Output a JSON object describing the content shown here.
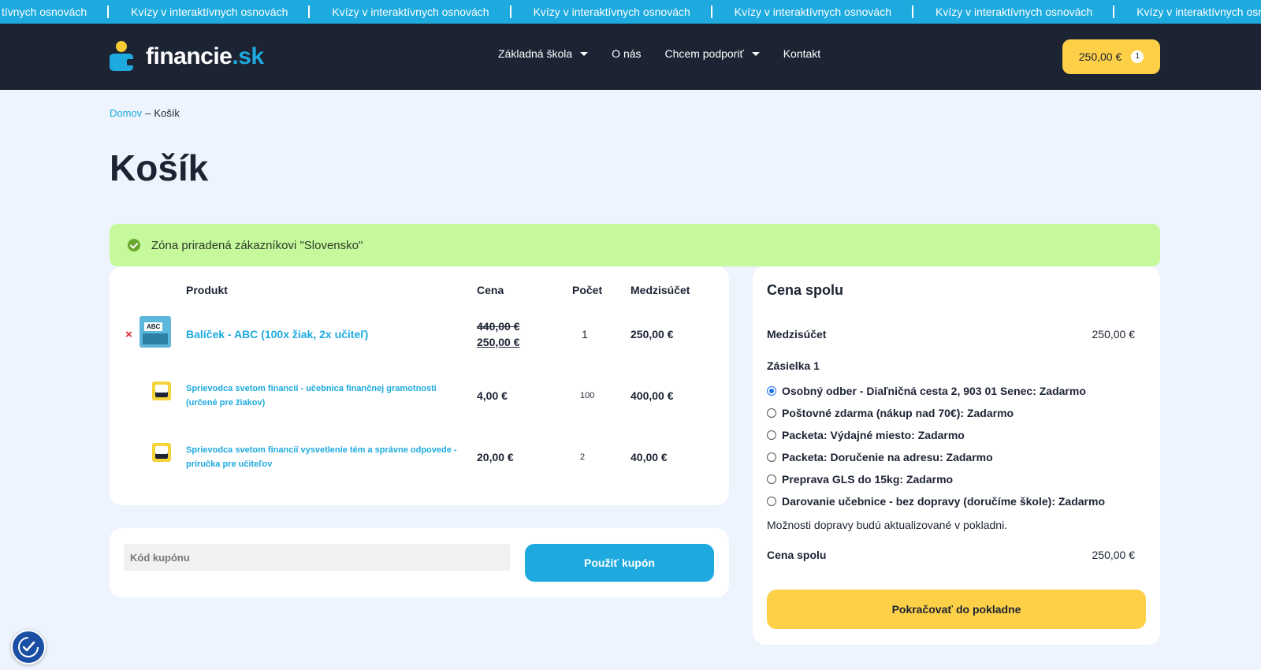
{
  "ticker": {
    "items": [
      "tívnych osnovách",
      "Kvízy v interaktívnych osnovách",
      "Kvízy v interaktívnych osnovách",
      "Kvízy v interaktívnych osnovách",
      "Kvízy v interaktívnych osnovách",
      "Kvízy v interaktívnych osnovách",
      "Kvízy v interaktívnych osnovách"
    ]
  },
  "header": {
    "logo_main": "financie",
    "logo_tld": ".sk",
    "nav": [
      {
        "label": "Základná škola",
        "icon": "chevron-down-icon"
      },
      {
        "label": "O nás"
      },
      {
        "label": "Chcem podporiť",
        "icon": "chevron-down-icon"
      },
      {
        "label": "Kontakt"
      }
    ],
    "cart_total": "250,00 €",
    "cart_count": "1"
  },
  "breadcrumb": {
    "home": "Domov",
    "separator": "–",
    "current": "Košík"
  },
  "page_title": "Košík",
  "notice": {
    "icon": "check-circle-icon",
    "text": "Zóna priradená zákazníkovi \"Slovensko\""
  },
  "cart": {
    "headers": {
      "product": "Produkt",
      "price": "Cena",
      "qty": "Počet",
      "subtotal": "Medzisúčet"
    },
    "items": [
      {
        "name": "Balíček - ABC (100x žiak, 2x učiteľ)",
        "old_price": "440,00 €",
        "price": "250,00 €",
        "qty": "1",
        "subtotal": "250,00 €",
        "remove_icon": "×"
      },
      {
        "name": "Sprievodca svetom financií - učebnica finančnej gramotnosti (určené pre žiakov)",
        "price": "4,00 €",
        "qty": "100",
        "subtotal": "400,00 €"
      },
      {
        "name": "Sprievodca svetom financií vysvetlenie tém a správne odpovede - príručka pre učiteľov",
        "price": "20,00 €",
        "qty": "2",
        "subtotal": "40,00 €"
      }
    ]
  },
  "coupon": {
    "placeholder": "Kód kupónu",
    "button": "Použiť kupón"
  },
  "totals": {
    "title": "Cena spolu",
    "subtotal_label": "Medzisúčet",
    "subtotal_value": "250,00 €",
    "shipment_label": "Zásielka 1",
    "shipping_options": [
      {
        "label": "Osobný odber - Diaľničná cesta 2, 903 01 Senec: Zadarmo",
        "selected": true
      },
      {
        "label": "Poštovné zdarma (nákup nad 70€): Zadarmo",
        "selected": false
      },
      {
        "label": "Packeta: Výdajné miesto: Zadarmo",
        "selected": false
      },
      {
        "label": "Packeta: Doručenie na adresu: Zadarmo",
        "selected": false
      },
      {
        "label": "Preprava GLS do 15kg: Zadarmo",
        "selected": false
      },
      {
        "label": "Darovanie učebnice - bez dopravy (doručíme škole): Zadarmo",
        "selected": false
      }
    ],
    "shipping_note": "Možnosti dopravy budú aktualizované v pokladni.",
    "total_label": "Cena spolu",
    "total_value": "250,00 €",
    "checkout_button": "Pokračovať do pokladne"
  },
  "accessibility": {
    "icon": "accessibility-icon"
  },
  "colors": {
    "brand_dark": "#1c2333",
    "brand_blue": "#1eaadf",
    "brand_yellow": "#fdd048",
    "notice_green": "#c6f99b",
    "page_bg": "#eef4fd"
  }
}
